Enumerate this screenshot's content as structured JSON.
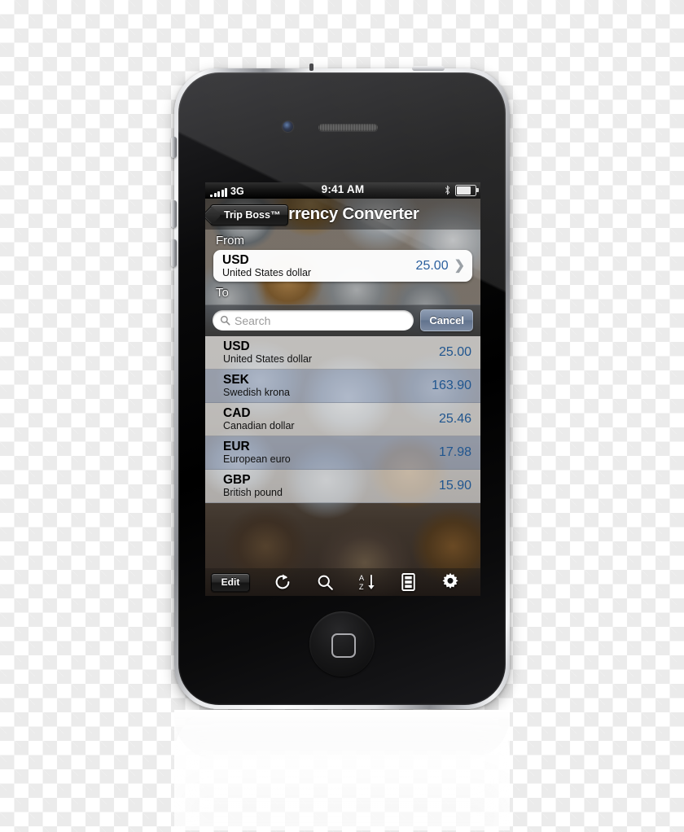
{
  "device": {
    "name": "iPhone 4",
    "home_button": "home-button",
    "silencer": "silent-switch",
    "volume_up": "volume-up-button",
    "volume_down": "volume-down-button",
    "power": "power-button"
  },
  "status_bar": {
    "signal_bars": 5,
    "carrier": "3G",
    "time": "9:41 AM",
    "bluetooth_icon": "bluetooth-icon",
    "battery_icon": "battery-icon",
    "battery_level_pct": 82
  },
  "nav_bar": {
    "back_label": "Trip Boss™",
    "title": "Currency Converter"
  },
  "from_section": {
    "label": "From",
    "cell": {
      "code": "USD",
      "name": "United States dollar",
      "value": "25.00",
      "disclosure_icon": "chevron-right-icon"
    }
  },
  "to_section": {
    "label": "To"
  },
  "search": {
    "icon": "search-icon",
    "placeholder": "Search",
    "value": "",
    "cancel_label": "Cancel"
  },
  "currency_rows": [
    {
      "code": "USD",
      "name": "United States dollar",
      "value": "25.00"
    },
    {
      "code": "SEK",
      "name": "Swedish krona",
      "value": "163.90"
    },
    {
      "code": "CAD",
      "name": "Canadian dollar",
      "value": "25.46"
    },
    {
      "code": "EUR",
      "name": "European euro",
      "value": "17.98"
    },
    {
      "code": "GBP",
      "name": "British pound",
      "value": "15.90"
    }
  ],
  "toolbar": {
    "edit_label": "Edit",
    "icons": [
      {
        "name": "refresh-icon",
        "label": "Refresh"
      },
      {
        "name": "search-icon",
        "label": "Search"
      },
      {
        "name": "sort-az-icon",
        "label": "Sort A to Z"
      },
      {
        "name": "drawer-list-icon",
        "label": "List"
      },
      {
        "name": "gear-icon",
        "label": "Settings"
      }
    ]
  },
  "colors": {
    "value_blue": "#21568f",
    "cancel_button": "#6f7f98",
    "row_even": "#b0bed8",
    "row_odd": "#f3f5f7",
    "status_bar": "#000000"
  }
}
